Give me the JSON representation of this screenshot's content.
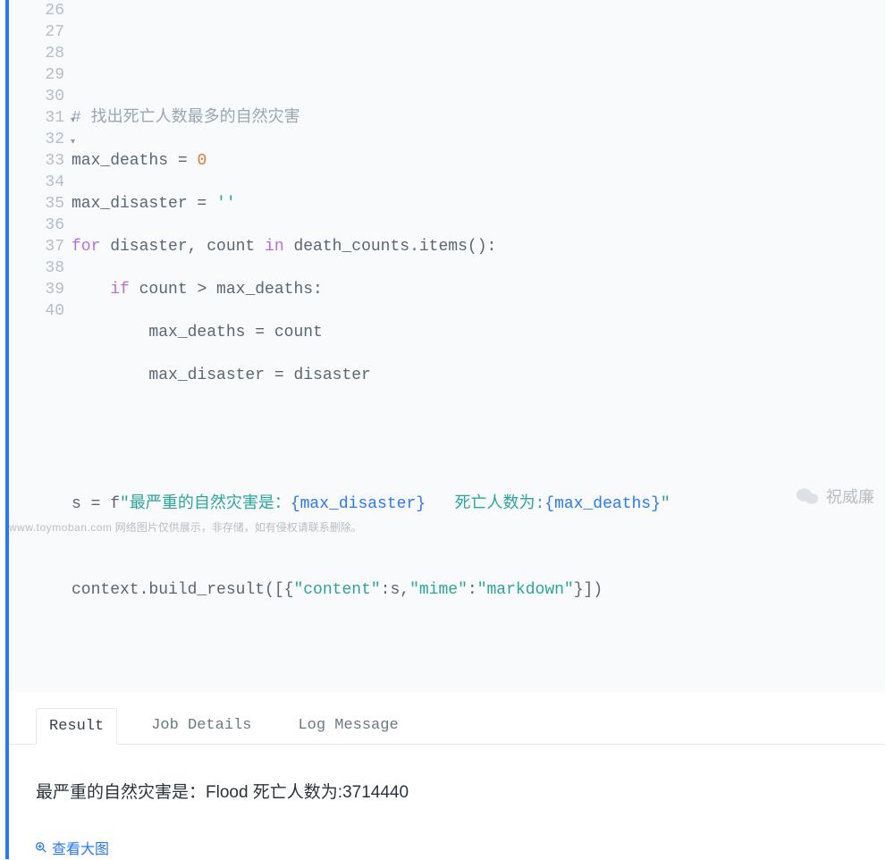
{
  "gutter": {
    "lines": [
      "26",
      "27",
      "28",
      "29",
      "30",
      "31",
      "32",
      "33",
      "34",
      "35",
      "36",
      "37",
      "38",
      "39",
      "40"
    ],
    "fold_at": [
      "31",
      "32"
    ]
  },
  "code": {
    "l28_comment": "# 找出死亡人数最多的自然灾害",
    "l29_a": "max_deaths = ",
    "l29_num": "0",
    "l30_a": "max_disaster = ",
    "l30_str": "''",
    "l31_kw1": "for",
    "l31_mid": " disaster, count ",
    "l31_kw2": "in",
    "l31_tail": " death_counts.items():",
    "l32_lead": "    ",
    "l32_kw": "if",
    "l32_tail": " count > max_deaths:",
    "l33": "        max_deaths = count",
    "l34": "        max_disaster = disaster",
    "l37_a": "s = f",
    "l37_s1": "\"最严重的自然灾害是：",
    "l37_p1": "{max_disaster}",
    "l37_s2": "   死亡人数为:",
    "l37_p2": "{max_deaths}",
    "l37_s3": "\"",
    "l39_a": "context.build_result([{",
    "l39_k1": "\"content\"",
    "l39_b": ":s,",
    "l39_k2": "\"mime\"",
    "l39_c": ":",
    "l39_v2": "\"markdown\"",
    "l39_d": "}])"
  },
  "tabs": {
    "result": "Result",
    "job": "Job Details",
    "log": "Log Message"
  },
  "result_text": "最严重的自然灾害是：Flood 死亡人数为:3714440",
  "view_large": "查看大图",
  "watermark": "祝威廉",
  "footer": {
    "domain": "www.toymoban.com",
    "note": " 网络图片仅供展示，非存储，如有侵权请联系删除。"
  }
}
